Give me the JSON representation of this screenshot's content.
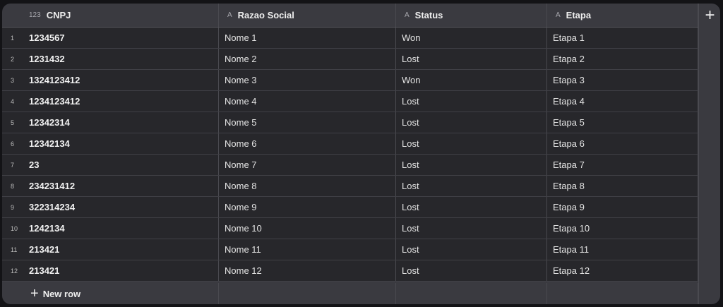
{
  "columns": [
    {
      "type_icon": "123",
      "label": "CNPJ"
    },
    {
      "type_icon": "A",
      "label": "Razao Social"
    },
    {
      "type_icon": "A",
      "label": "Status"
    },
    {
      "type_icon": "A",
      "label": "Etapa"
    }
  ],
  "add_column_icon": "+",
  "rows": [
    {
      "n": "1",
      "cnpj": "1234567",
      "razao": "Nome 1",
      "status": "Won",
      "etapa": "Etapa 1"
    },
    {
      "n": "2",
      "cnpj": "1231432",
      "razao": "Nome 2",
      "status": "Lost",
      "etapa": "Etapa 2"
    },
    {
      "n": "3",
      "cnpj": "1324123412",
      "razao": "Nome 3",
      "status": "Won",
      "etapa": "Etapa 3"
    },
    {
      "n": "4",
      "cnpj": "1234123412",
      "razao": "Nome 4",
      "status": "Lost",
      "etapa": "Etapa 4"
    },
    {
      "n": "5",
      "cnpj": "12342314",
      "razao": "Nome 5",
      "status": "Lost",
      "etapa": "Etapa 5"
    },
    {
      "n": "6",
      "cnpj": "12342134",
      "razao": "Nome 6",
      "status": "Lost",
      "etapa": "Etapa 6"
    },
    {
      "n": "7",
      "cnpj": "23",
      "razao": "Nome 7",
      "status": "Lost",
      "etapa": "Etapa 7"
    },
    {
      "n": "8",
      "cnpj": "234231412",
      "razao": "Nome 8",
      "status": "Lost",
      "etapa": "Etapa 8"
    },
    {
      "n": "9",
      "cnpj": "322314234",
      "razao": "Nome 9",
      "status": "Lost",
      "etapa": "Etapa 9"
    },
    {
      "n": "10",
      "cnpj": "1242134",
      "razao": "Nome 10",
      "status": "Lost",
      "etapa": "Etapa 10"
    },
    {
      "n": "11",
      "cnpj": "213421",
      "razao": "Nome 11",
      "status": "Lost",
      "etapa": "Etapa 11"
    },
    {
      "n": "12",
      "cnpj": "213421",
      "razao": "Nome 12",
      "status": "Lost",
      "etapa": "Etapa 12"
    }
  ],
  "footer": {
    "icon": "+",
    "label": "New row"
  }
}
